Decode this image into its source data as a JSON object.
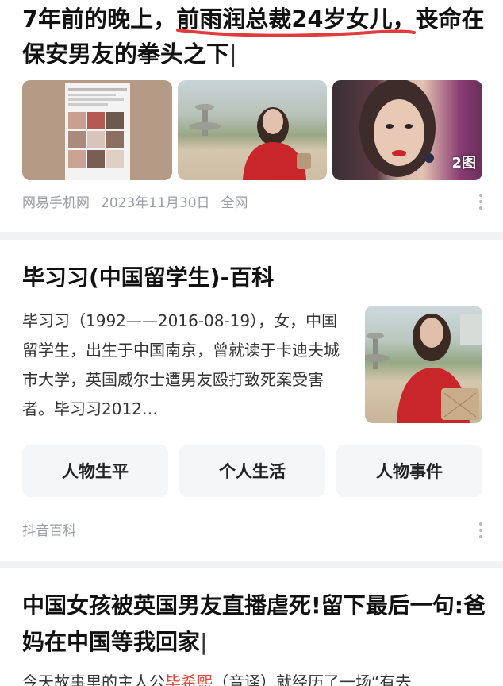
{
  "card1": {
    "title_before": "7年前的晚上，",
    "title_highlight": "前雨润总裁24岁女儿，",
    "title_after": "丧命在保安男友的拳头之下",
    "image_badge": "2图",
    "source": "网易手机网",
    "date": "2023年11月30日",
    "scope": "全网"
  },
  "card2": {
    "title": "毕习习(中国留学生)-百科",
    "description": "毕习习（1992——2016-08-19），女，中国留学生，出生于中国南京，曾就读于卡迪夫城市大学，英国威尔士遭男友殴打致死案受害者。毕习习2012…",
    "buttons": [
      "人物生平",
      "个人生活",
      "人物事件"
    ],
    "source": "抖音百科"
  },
  "card3": {
    "title": "中国女孩被英国男友直播虐死!留下最后一句:爸妈在中国等我回家",
    "desc_before": "今天故事里的主人公",
    "desc_name": "毕希熙",
    "desc_after": "（音译）就经历了一场“有去"
  },
  "colors": {
    "highlight_underline": "#e23b3b",
    "meta_gray": "#9a9ea6",
    "name_red": "#e2473a"
  }
}
